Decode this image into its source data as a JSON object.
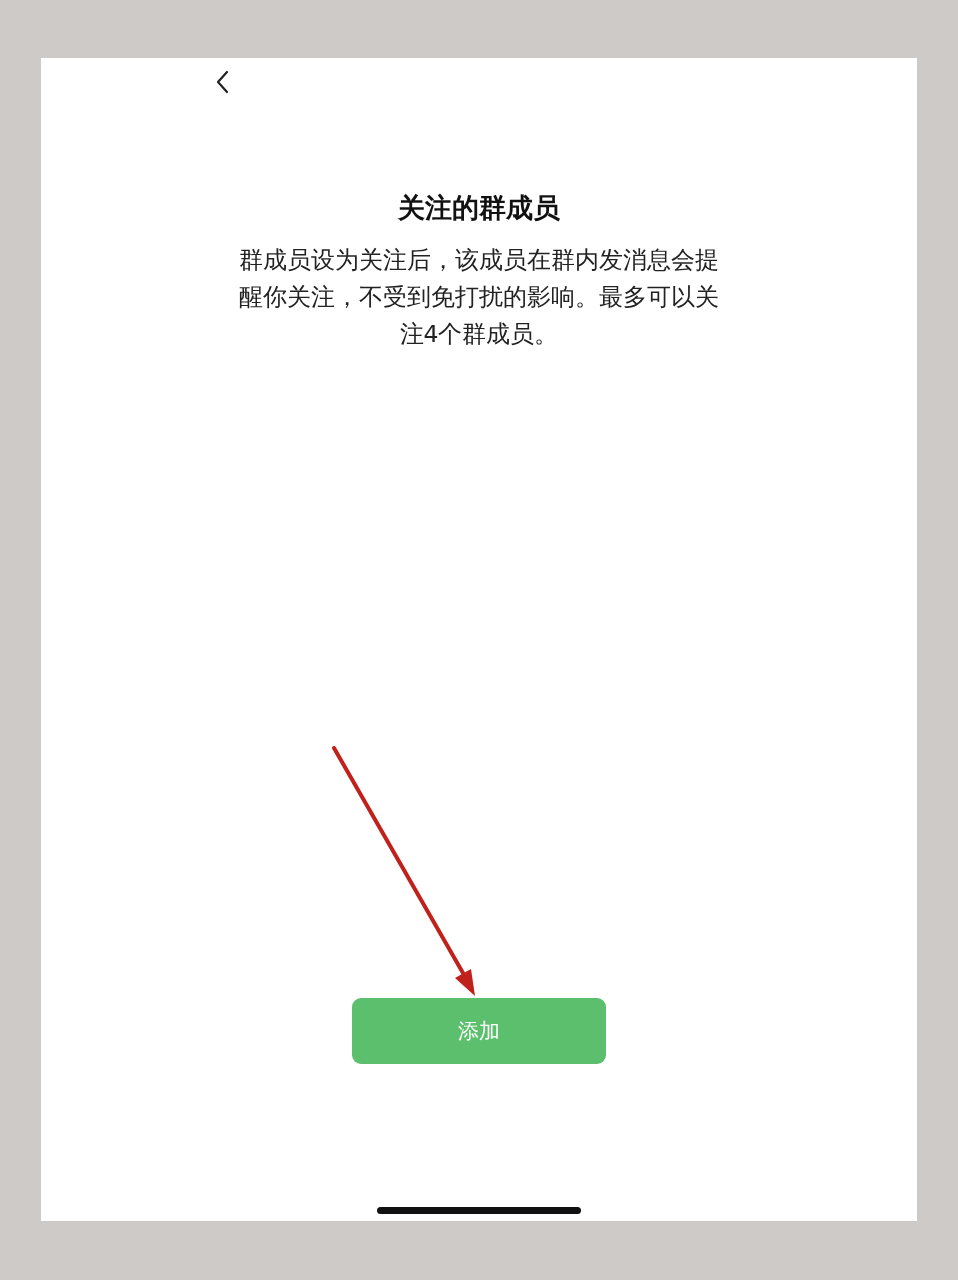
{
  "title": "关注的群成员",
  "description": "群成员设为关注后，该成员在群内发消息会提醒你关注，不受到免打扰的影响。最多可以关注4个群成员。",
  "add_button": {
    "label": "添加"
  }
}
